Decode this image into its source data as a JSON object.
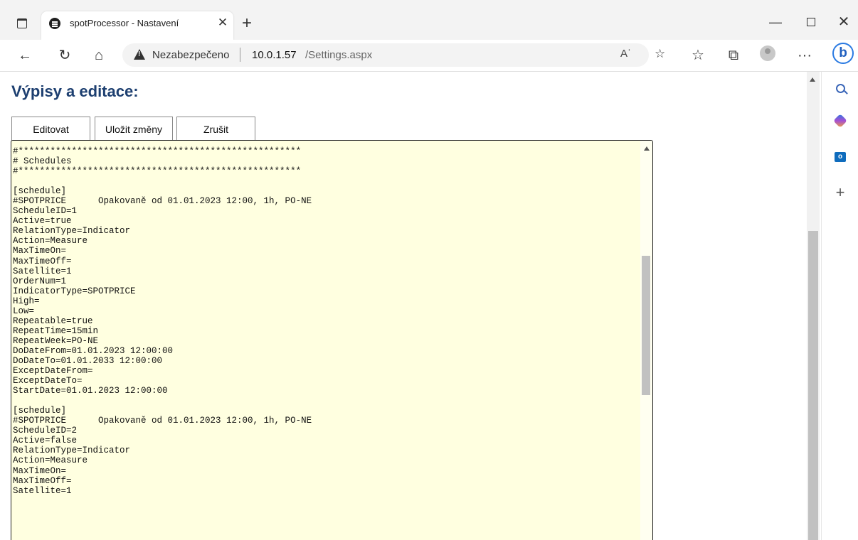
{
  "browser": {
    "tab_title": "spotProcessor - Nastavení",
    "tab_close": "✕",
    "new_tab": "+",
    "window_min": "—",
    "window_close": "✕",
    "address_warning": "Nezabezpečeno",
    "address_host": "10.0.1.57",
    "address_path": "/Settings.aspx",
    "more_menu": "···",
    "profile_icon": "profile-icon"
  },
  "page": {
    "heading": "Výpisy a editace:",
    "buttons": {
      "edit": "Editovat",
      "save": "Uložit změny",
      "cancel": "Zrušit"
    },
    "editor_text": "#*****************************************************\n# Schedules\n#*****************************************************\n\n[schedule]\n#SPOTPRICE      Opakovaně od 01.01.2023 12:00, 1h, PO-NE\nScheduleID=1\nActive=true\nRelationType=Indicator\nAction=Measure\nMaxTimeOn=\nMaxTimeOff=\nSatellite=1\nOrderNum=1\nIndicatorType=SPOTPRICE\nHigh=\nLow=\nRepeatable=true\nRepeatTime=15min\nRepeatWeek=PO-NE\nDoDateFrom=01.01.2023 12:00:00\nDoDateTo=01.01.2033 12:00:00\nExceptDateFrom=\nExceptDateTo=\nStartDate=01.01.2023 12:00:00\n\n[schedule]\n#SPOTPRICE      Opakovaně od 01.01.2023 12:00, 1h, PO-NE\nScheduleID=2\nActive=false\nRelationType=Indicator\nAction=Measure\nMaxTimeOn=\nMaxTimeOff=\nSatellite=1"
  }
}
